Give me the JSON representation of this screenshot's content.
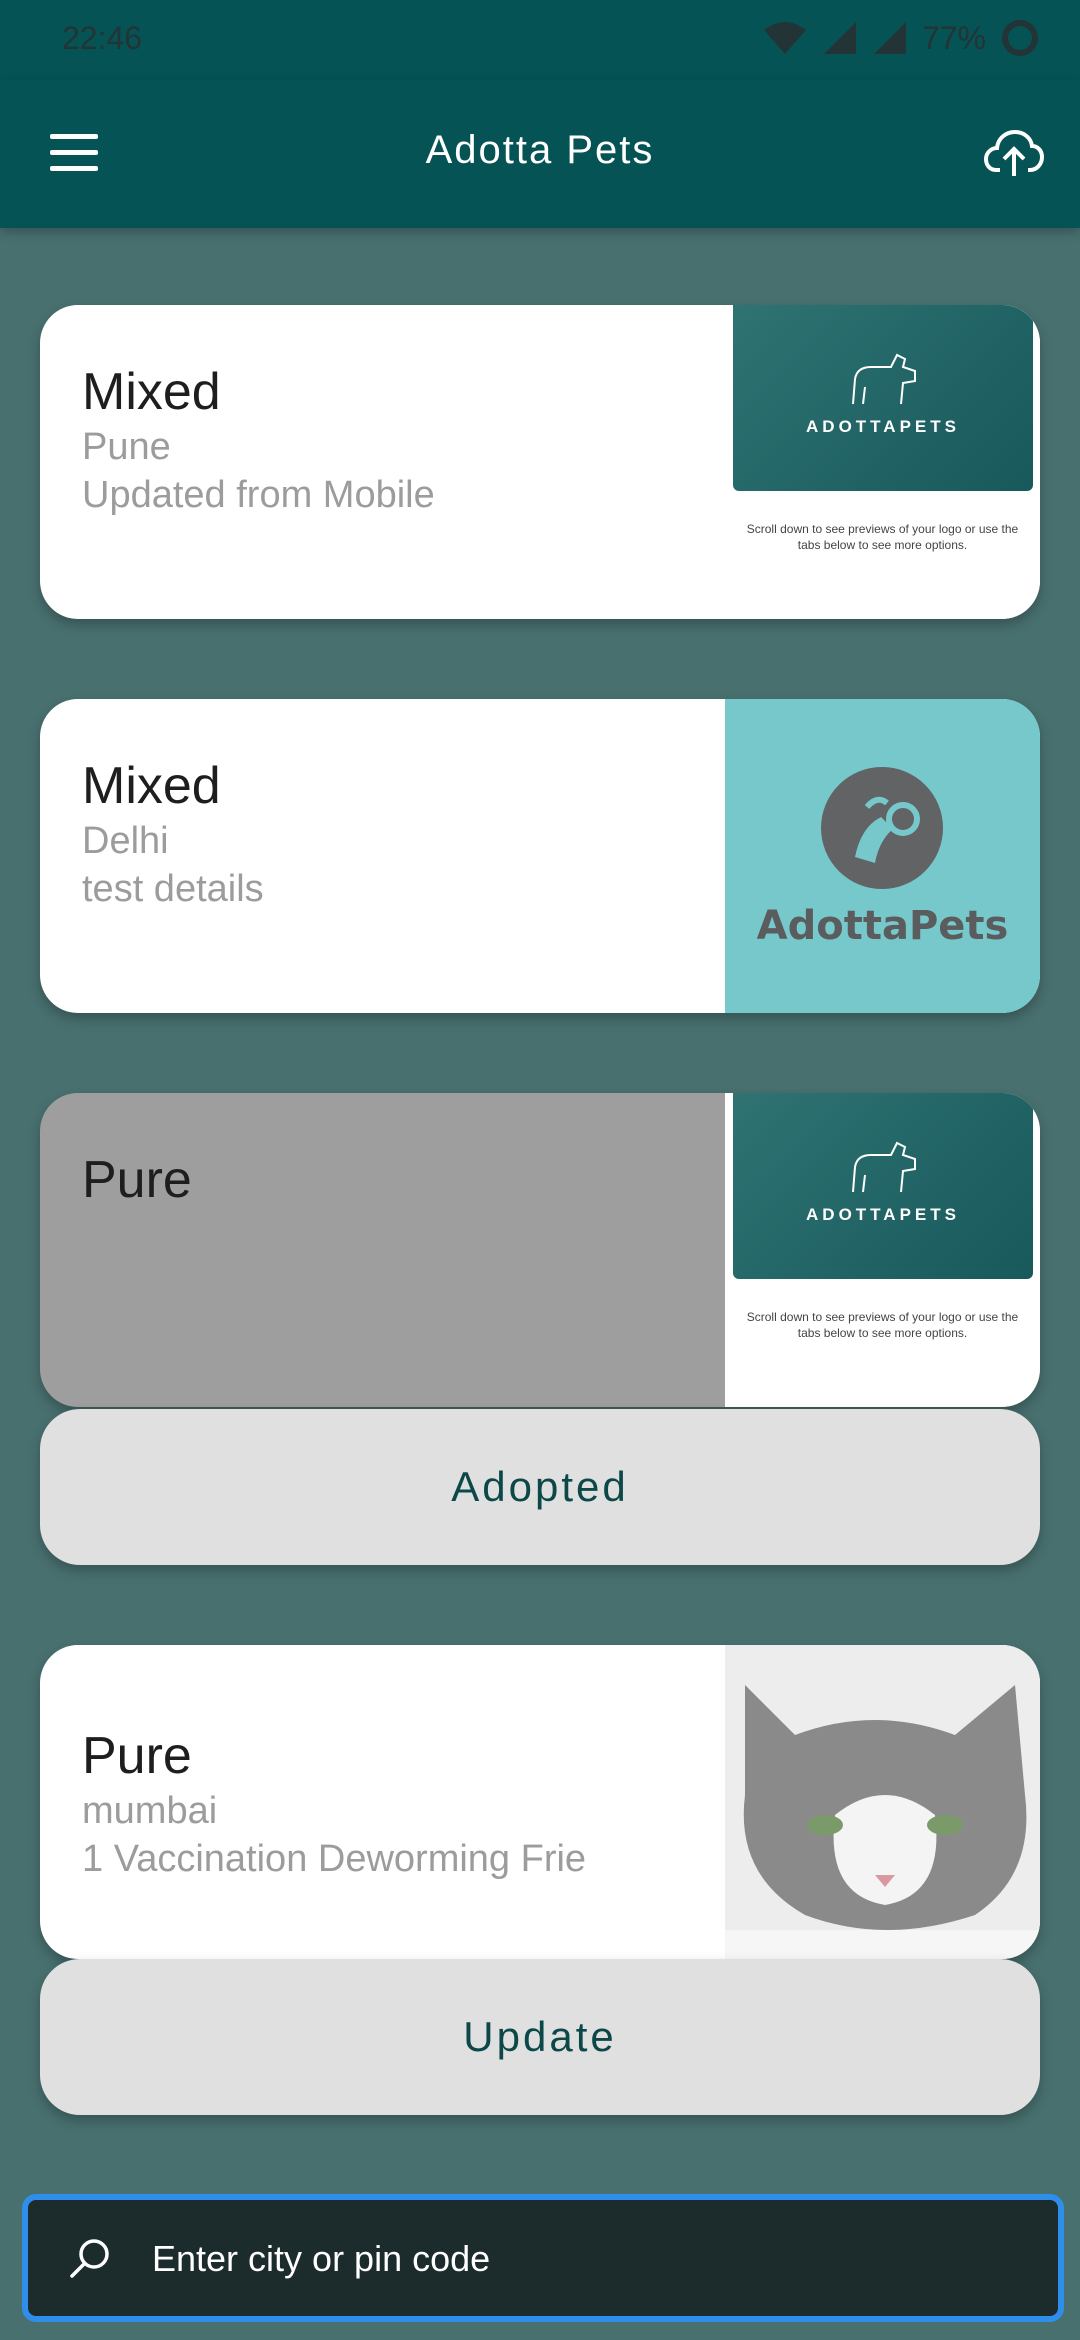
{
  "status_bar": {
    "time": "22:46",
    "battery_percent": "77%"
  },
  "app_bar": {
    "title": "Adotta Pets",
    "menu_icon": "hamburger-menu-icon",
    "upload_icon": "cloud-upload-icon"
  },
  "listings": [
    {
      "breed": "Mixed",
      "city": "Pune",
      "description": "Updated from Mobile",
      "image": "adottapets-banner",
      "banner_wordmark": "ADOTTAPETS",
      "banner_caption": "Scroll down to see previews of your logo or use the tabs below to see more options."
    },
    {
      "breed": "Mixed",
      "city": "Delhi",
      "description": "test details",
      "image": "adottapets-cyan-logo",
      "logo_text": "AdottaPets"
    },
    {
      "breed": "Pure",
      "image": "adottapets-banner",
      "banner_wordmark": "ADOTTAPETS",
      "banner_caption": "Scroll down to see previews of your logo or use the tabs below to see more options.",
      "action_label": "Adopted"
    },
    {
      "breed": "Pure",
      "city": "mumbai",
      "description": "1 Vaccination Deworming Frie",
      "image": "cat-photo",
      "action_label": "Update"
    }
  ],
  "search": {
    "placeholder": "Enter city or pin code",
    "icon": "search-icon"
  },
  "colors": {
    "app_bar": "#055355",
    "background": "#48706f",
    "card": "#ffffff",
    "adopted_card": "#9e9e9e",
    "action_button": "#e0e0e0",
    "search_border": "#2f8ee9"
  }
}
